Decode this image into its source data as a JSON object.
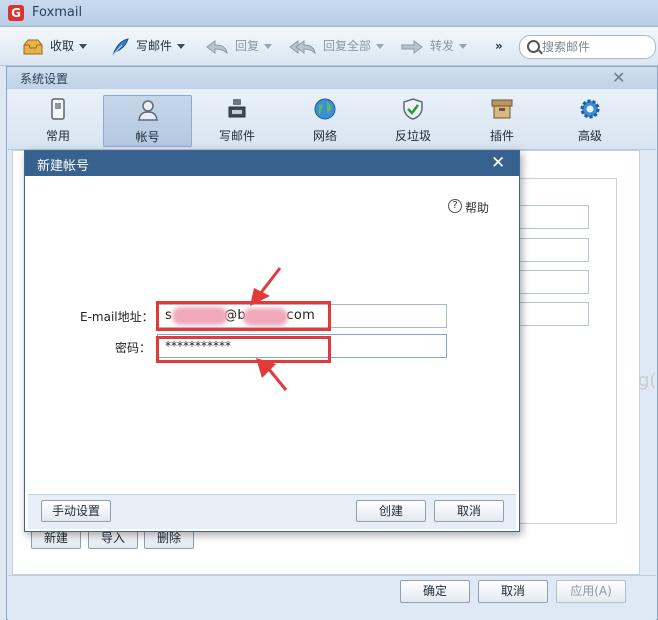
{
  "app": {
    "title": "Foxmail",
    "logo_letter": "G"
  },
  "toolbar": {
    "receive": "收取",
    "compose": "写邮件",
    "reply": "回复",
    "reply_all": "回复全部",
    "forward": "转发",
    "more": "»",
    "search_placeholder": "搜索邮件"
  },
  "settings": {
    "title": "系统设置",
    "close": "✕",
    "tabs": [
      {
        "label": "常用",
        "icon": "general-icon"
      },
      {
        "label": "帐号",
        "icon": "account-icon",
        "active": true
      },
      {
        "label": "写邮件",
        "icon": "compose-icon"
      },
      {
        "label": "网络",
        "icon": "network-icon"
      },
      {
        "label": "反垃圾",
        "icon": "antispam-icon"
      },
      {
        "label": "插件",
        "icon": "plugin-icon"
      },
      {
        "label": "高级",
        "icon": "advanced-icon"
      }
    ],
    "account_buttons": {
      "new": "新建",
      "import": "导入",
      "delete": "删除"
    },
    "footer": {
      "ok": "确定",
      "cancel": "取消",
      "apply": "应用(A)"
    },
    "watermark": "g("
  },
  "dialog": {
    "title": "新建帐号",
    "close": "✕",
    "help": "帮助",
    "help_icon": "?",
    "email_label": "E-mail地址：",
    "email_value": "s@b.com",
    "email_parts": {
      "prefix": "s",
      "at": "@b",
      "suffix": ".com"
    },
    "password_label": "密码：",
    "password_value": "***********",
    "manual_setup": "手动设置",
    "create": "创建",
    "cancel": "取消"
  },
  "colors": {
    "highlight": "#e23a3a",
    "dialog_title_bg": "#37618f"
  }
}
